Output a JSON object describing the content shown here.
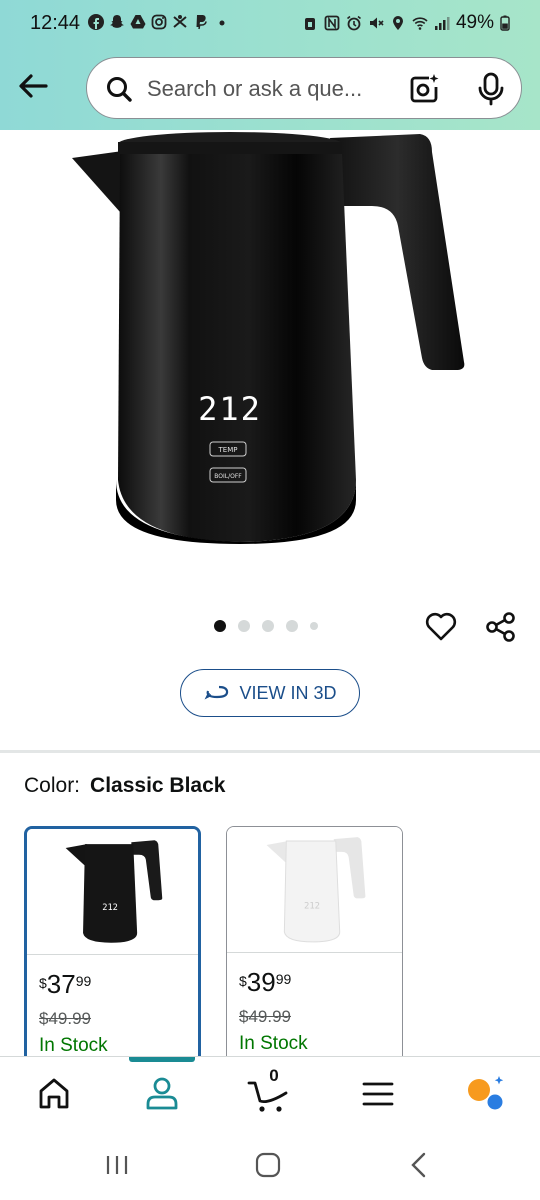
{
  "status_bar": {
    "time": "12:44",
    "battery": "49%",
    "icons_left": [
      "facebook-icon",
      "snapchat-icon",
      "drive-icon",
      "instagram-icon",
      "bluetooth-person-icon",
      "paypal-icon",
      "dot-icon"
    ],
    "icons_right": [
      "lock-icon",
      "nfc-icon",
      "alarm-icon",
      "mute-icon",
      "location-icon",
      "wifi-icon",
      "signal-icon",
      "battery-icon"
    ]
  },
  "search": {
    "placeholder": "Search or ask a que..."
  },
  "product": {
    "display_number": "212",
    "temp_button": "TEMP",
    "boil_button": "BOIL/OFF"
  },
  "carousel": {
    "count": 5,
    "active_index": 0
  },
  "view_3d": {
    "label": "VIEW IN 3D"
  },
  "color": {
    "label": "Color:",
    "value": "Classic Black"
  },
  "swatches": [
    {
      "symbol": "$",
      "whole": "37",
      "fraction": "99",
      "list_price": "$49.99",
      "stock": "In Stock",
      "selected": true,
      "color": "#1a1a1a"
    },
    {
      "symbol": "$",
      "whole": "39",
      "fraction": "99",
      "list_price": "$49.99",
      "stock": "In Stock",
      "selected": false,
      "color": "#f4f4f4"
    }
  ],
  "bottom_nav": {
    "items": [
      "home-icon",
      "account-icon",
      "cart-icon",
      "menu-icon",
      "rufus-icon"
    ],
    "active_index": 1,
    "cart_count": "0"
  },
  "colors": {
    "header_gradient_start": "#8fd9d6",
    "header_gradient_end": "#a7e5c9",
    "link_blue": "#1b4e8a",
    "in_stock_green": "#007600",
    "teal_indicator": "#1a8b94",
    "rufus_orange": "#f79a1e",
    "rufus_blue": "#2a7de1"
  }
}
